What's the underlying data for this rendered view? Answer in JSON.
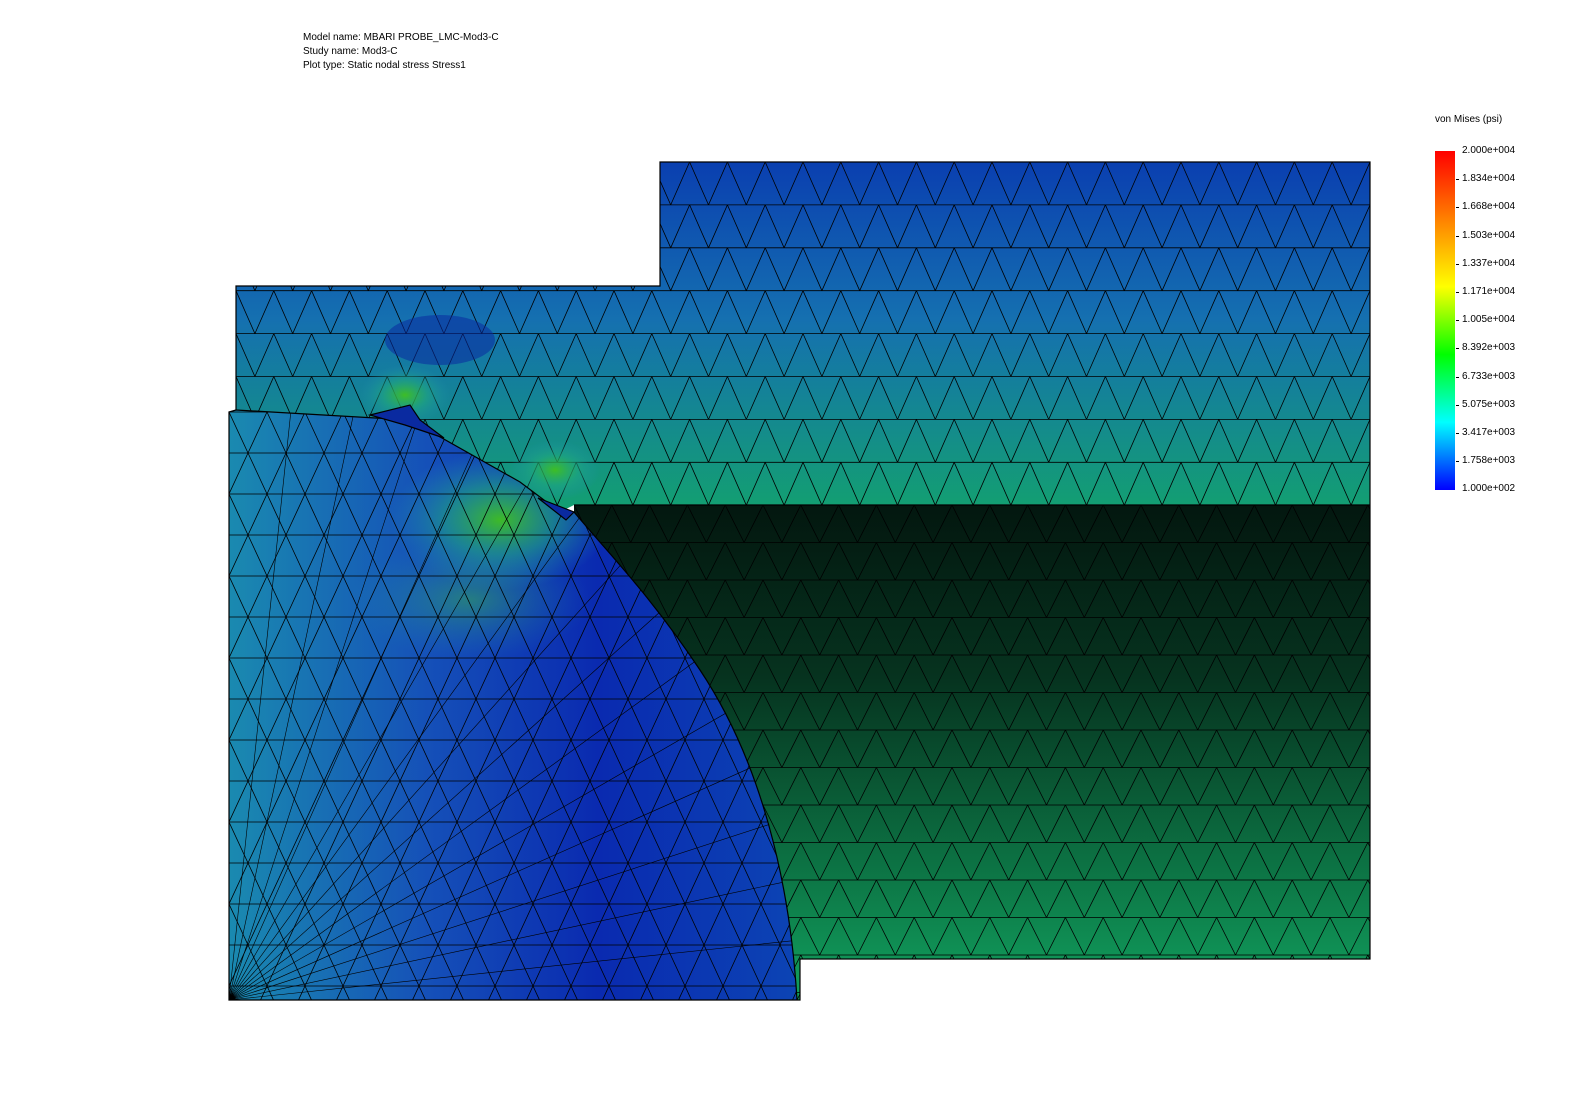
{
  "header": {
    "model_name": "Model name: MBARI PROBE_LMC-Mod3-C",
    "study_name": "Study name: Mod3-C",
    "plot_type": "Plot type: Static nodal stress Stress1"
  },
  "legend": {
    "title": "von Mises (psi)",
    "ticks": [
      "2.000e+004",
      "1.834e+004",
      "1.668e+004",
      "1.503e+004",
      "1.337e+004",
      "1.171e+004",
      "1.005e+004",
      "8.392e+003",
      "6.733e+003",
      "5.075e+003",
      "3.417e+003",
      "1.758e+003",
      "1.000e+002"
    ],
    "colors": [
      "#ff0000",
      "#ff8000",
      "#ffff00",
      "#00ff00",
      "#00ffff",
      "#0000ff"
    ]
  },
  "colors": {
    "mesh_line": "#000000",
    "hole_left": "#1446b4",
    "hole_dark": "#062a1c",
    "flange_top": "#0a3fb0",
    "flange_mid": "#1570b0",
    "flange_bottom": "#12a07a",
    "right_lower_dark": "#051e14",
    "right_lower_bottom": "#12a060"
  }
}
